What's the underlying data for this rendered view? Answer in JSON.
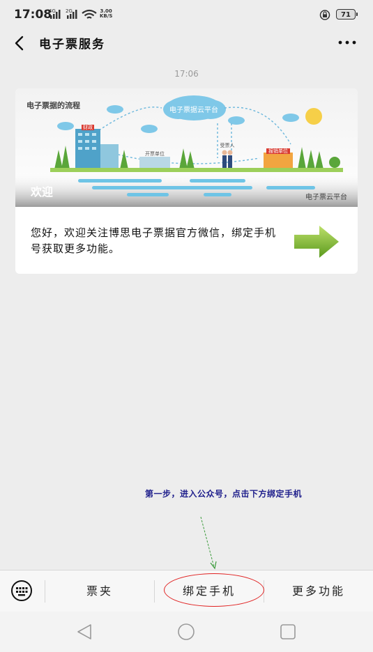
{
  "status_bar": {
    "time": "17:08",
    "sim1": "4G",
    "sim2": "2G",
    "speed_value": "3.00",
    "speed_unit": "KB/S",
    "battery": "71",
    "icons": [
      "signal-icon",
      "wifi-icon",
      "lock-icon",
      "battery-icon"
    ]
  },
  "nav": {
    "title": "电子票服务",
    "back_icon": "chevron-left-icon",
    "more_icon": "more-dots-icon"
  },
  "chat": {
    "timestamp": "17:06",
    "card": {
      "banner_heading": "电子票据的流程",
      "banner_cloud": "电子票据云平台",
      "banner_labels": [
        "财政",
        "开票单位",
        "受票人",
        "报销单位"
      ],
      "banner_caption": "欢迎",
      "banner_watermark": "电子票云平台",
      "message": "您好，欢迎关注博思电子票据官方微信，绑定手机号获取更多功能。",
      "arrow_icon": "arrow-right-icon"
    }
  },
  "annotation": {
    "hint": "第一步，进入公众号，点击下方绑定手机",
    "color": "#e02020"
  },
  "menu": {
    "keyboard_icon": "keyboard-icon",
    "items": [
      "票夹",
      "绑定手机",
      "更多功能"
    ]
  },
  "system_nav": [
    "back-triangle-icon",
    "home-circle-icon",
    "recent-square-icon"
  ]
}
